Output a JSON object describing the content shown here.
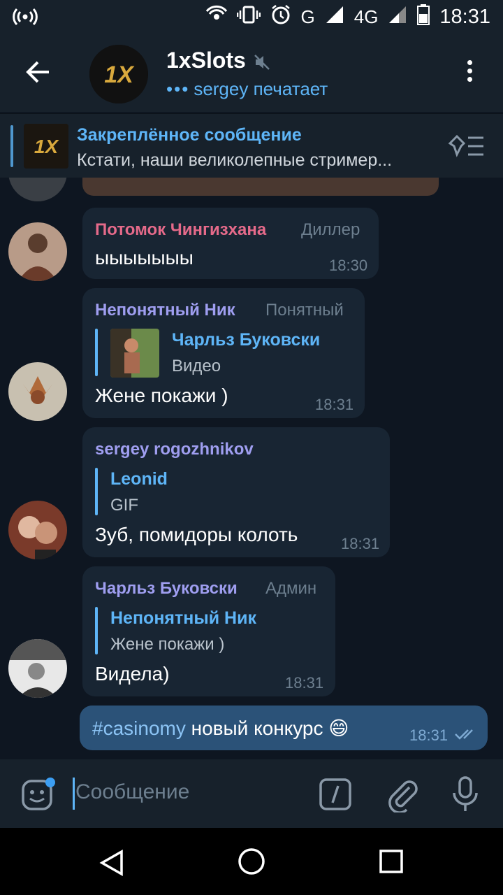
{
  "status_bar": {
    "network": "G",
    "network2": "4G",
    "time": "18:31"
  },
  "header": {
    "title": "1xSlots",
    "status_user": "sergey",
    "status_action": "печатает"
  },
  "pinned": {
    "title": "Закреплённое сообщение",
    "text": "Кстати, наши великолепные стример..."
  },
  "messages": [
    {
      "sender": "Потомок Чингизхана",
      "role": "Диллер",
      "text": "ыыыыыыы",
      "time": "18:30"
    },
    {
      "sender": "Непонятный Ник",
      "role": "Понятный",
      "reply_name": "Чарльз Буковски",
      "reply_text": "Видео",
      "text": "Жене покажи )",
      "time": "18:31"
    },
    {
      "sender": "sergey rogozhnikov",
      "reply_name": "Leonid",
      "reply_text": "GIF",
      "text": "Зуб, помидоры колоть",
      "time": "18:31"
    },
    {
      "sender": "Чарльз Буковски",
      "role": "Админ",
      "reply_name": "Непонятный Ник",
      "reply_text": "Жене покажи )",
      "text": "Видела)",
      "time": "18:31"
    }
  ],
  "outgoing": {
    "hashtag": "#casinomy",
    "text": "новый конкурс",
    "emoji": "😄",
    "time": "18:31"
  },
  "input": {
    "placeholder": "Сообщение"
  },
  "colors": {
    "background": "#0e1621",
    "bar": "#17212b",
    "bubble_in": "#182533",
    "bubble_out": "#2b5278",
    "accent": "#5eb5f7",
    "sender_pink": "#e56a8a",
    "sender_purple": "#9f9ef0"
  }
}
